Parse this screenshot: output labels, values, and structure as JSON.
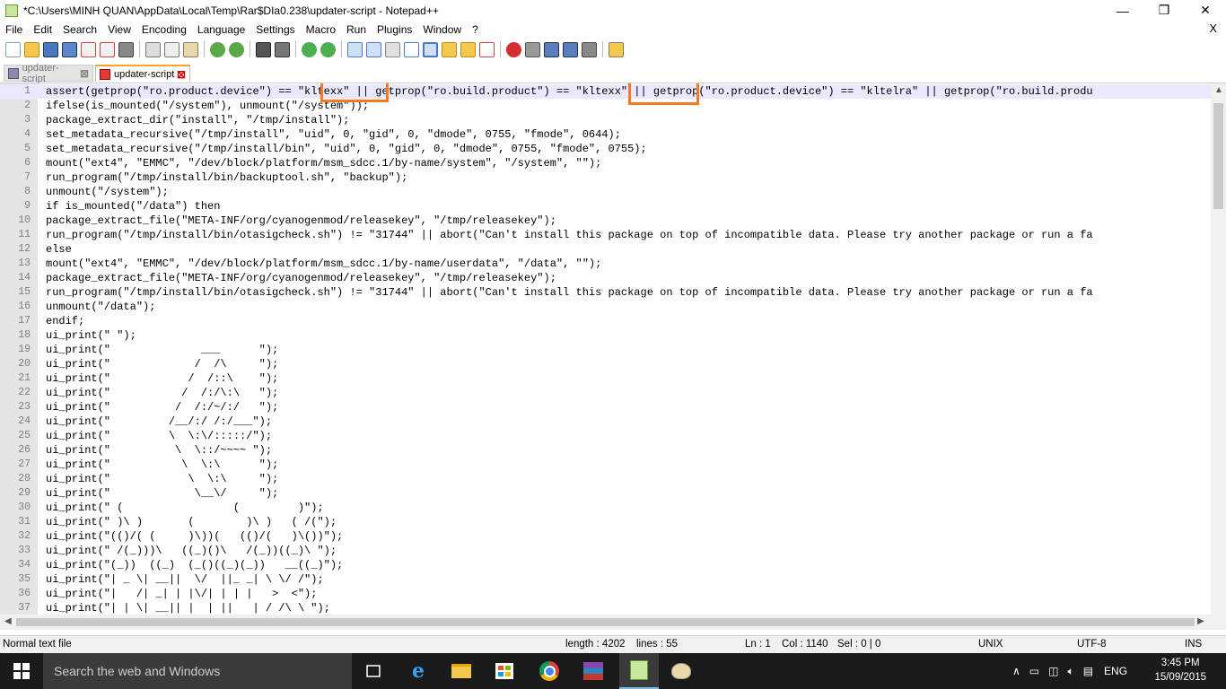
{
  "window": {
    "title": "*C:\\Users\\MINH QUAN\\AppData\\Local\\Temp\\Rar$DIa0.238\\updater-script - Notepad++",
    "minimize": "—",
    "restore": "❐",
    "close": "✕"
  },
  "menu": {
    "items": [
      "File",
      "Edit",
      "Search",
      "View",
      "Encoding",
      "Language",
      "Settings",
      "Macro",
      "Run",
      "Plugins",
      "Window",
      "?"
    ],
    "close": "X"
  },
  "tabs": [
    {
      "label": "updater-script",
      "close": "⊠"
    },
    {
      "label": "updater-script",
      "close": "⊠"
    }
  ],
  "editor": {
    "lines": [
      "assert(getprop(\"ro.product.device\") == \"kltexx\" || getprop(\"ro.build.product\") == \"kltexx\" || getprop(\"ro.product.device\") == \"kltelra\" || getprop(\"ro.build.produ",
      "ifelse(is_mounted(\"/system\"), unmount(\"/system\"));",
      "package_extract_dir(\"install\", \"/tmp/install\");",
      "set_metadata_recursive(\"/tmp/install\", \"uid\", 0, \"gid\", 0, \"dmode\", 0755, \"fmode\", 0644);",
      "set_metadata_recursive(\"/tmp/install/bin\", \"uid\", 0, \"gid\", 0, \"dmode\", 0755, \"fmode\", 0755);",
      "mount(\"ext4\", \"EMMC\", \"/dev/block/platform/msm_sdcc.1/by-name/system\", \"/system\", \"\");",
      "run_program(\"/tmp/install/bin/backuptool.sh\", \"backup\");",
      "unmount(\"/system\");",
      "if is_mounted(\"/data\") then",
      "package_extract_file(\"META-INF/org/cyanogenmod/releasekey\", \"/tmp/releasekey\");",
      "run_program(\"/tmp/install/bin/otasigcheck.sh\") != \"31744\" || abort(\"Can't install this package on top of incompatible data. Please try another package or run a fa",
      "else",
      "mount(\"ext4\", \"EMMC\", \"/dev/block/platform/msm_sdcc.1/by-name/userdata\", \"/data\", \"\");",
      "package_extract_file(\"META-INF/org/cyanogenmod/releasekey\", \"/tmp/releasekey\");",
      "run_program(\"/tmp/install/bin/otasigcheck.sh\") != \"31744\" || abort(\"Can't install this package on top of incompatible data. Please try another package or run a fa",
      "unmount(\"/data\");",
      "endif;",
      "ui_print(\" \");",
      "ui_print(\"              ___      \");",
      "ui_print(\"             /  /\\     \");",
      "ui_print(\"            /  /::\\    \");",
      "ui_print(\"           /  /:/\\:\\   \");",
      "ui_print(\"          /  /:/~/:/   \");",
      "ui_print(\"         /__/:/ /:/___\");",
      "ui_print(\"         \\  \\:\\/:::::/\");",
      "ui_print(\"          \\  \\::/~~~~ \");",
      "ui_print(\"           \\  \\:\\      \");",
      "ui_print(\"            \\  \\:\\     \");",
      "ui_print(\"             \\__\\/     \");",
      "ui_print(\" (                 (         )\");",
      "ui_print(\" )\\ )       (        )\\ )   ( /(\");",
      "ui_print(\"(()/( (     )\\))(   (()/(   )\\())\");",
      "ui_print(\" /(_)))\\   ((_)()\\   /(_))((_)\\ \");",
      "ui_print(\"(_))  ((_)  (_()((_)(_))   __((_)\");",
      "ui_print(\"| _ \\| __||  \\/  ||_ _| \\ \\/ /\");",
      "ui_print(\"|   /| _| | |\\/| | | |   >  <\");",
      "ui_print(\"| | \\| __|| |  | ||   | / /\\ \\ \");"
    ]
  },
  "status": {
    "filetype": "Normal text file",
    "length": "length : 4202",
    "lines": "lines : 55",
    "ln": "Ln : 1",
    "col": "Col : 1140",
    "sel": "Sel : 0 | 0",
    "eol": "UNIX",
    "encoding": "UTF-8",
    "mode": "INS"
  },
  "taskbar": {
    "search_placeholder": "Search the web and Windows",
    "language": "ENG",
    "time": "3:45 PM",
    "date": "15/09/2015"
  },
  "colors": {
    "highlight_box": "#f47b20",
    "current_line": "#e8e8ff",
    "tab_accent": "#f5a623"
  }
}
